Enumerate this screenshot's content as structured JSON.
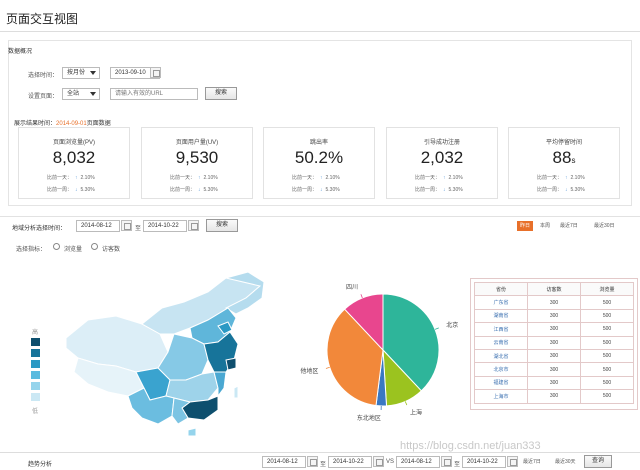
{
  "page": {
    "title": "页面交互视图"
  },
  "overview": {
    "section_title": "数据概况",
    "time_label": "选择时间：",
    "time_select": "按月份",
    "date_value": "2013-09-10",
    "page_label": "设置页面：",
    "page_select": "全站",
    "url_placeholder": "请输入有效的URL",
    "search_button": "搜索"
  },
  "display_time": {
    "prefix": "展示结果时间：",
    "date": "2014-09-01",
    "suffix": "页面数据"
  },
  "stats": [
    {
      "label": "页面浏览量(PV)",
      "value": "8,032",
      "unit": "",
      "day_label": "比前一天：",
      "day_value": "2.10%",
      "week_label": "比前一周：",
      "week_value": "5.30%"
    },
    {
      "label": "页面用户量(UV)",
      "value": "9,530",
      "unit": "",
      "day_label": "比前一天：",
      "day_value": "2.10%",
      "week_label": "比前一周：",
      "week_value": "5.30%"
    },
    {
      "label": "跳出率",
      "value": "50.2%",
      "unit": "",
      "day_label": "比前一天：",
      "day_value": "2.10%",
      "week_label": "比前一周：",
      "week_value": "5.30%"
    },
    {
      "label": "引导成功注册",
      "value": "2,032",
      "unit": "",
      "day_label": "比前一天：",
      "day_value": "2.10%",
      "week_label": "比前一周：",
      "week_value": "5.30%"
    },
    {
      "label": "平均停留时间",
      "value": "88",
      "unit": "s",
      "day_label": "比前一天：",
      "day_value": "2.10%",
      "week_label": "比前一周：",
      "week_value": "5.30%"
    }
  ],
  "geo": {
    "title": "地域分析",
    "time_label": "选择时间：",
    "date_from": "2014-08-12",
    "to_label": "至",
    "date_to": "2014-10-22",
    "search_button": "搜索",
    "quick": [
      "昨日",
      "本周",
      "最近7日",
      "最近30日"
    ],
    "metric_label": "选择指标：",
    "metric_pv": "浏览量",
    "metric_uv": "访客数",
    "legend_high": "高",
    "legend_low": "低"
  },
  "chart_data": {
    "type": "pie",
    "labels": [
      "北京",
      "上海",
      "东北地区",
      "其他地区",
      "四川"
    ],
    "values": [
      38,
      11,
      3,
      36,
      12
    ],
    "colors": [
      "#2eb59a",
      "#9bc31f",
      "#3a78c2",
      "#f2883a",
      "#e8468e"
    ]
  },
  "table": {
    "headers": [
      "省份",
      "访客数",
      "浏览量"
    ],
    "rows": [
      [
        "广东省",
        "300",
        "500"
      ],
      [
        "湖南省",
        "300",
        "500"
      ],
      [
        "江西省",
        "300",
        "500"
      ],
      [
        "云南省",
        "300",
        "500"
      ],
      [
        "湖北省",
        "300",
        "500"
      ],
      [
        "北京市",
        "300",
        "500"
      ],
      [
        "福建省",
        "300",
        "500"
      ],
      [
        "上海市",
        "300",
        "500"
      ]
    ]
  },
  "trend": {
    "title": "趋势分析",
    "date_a_from": "2014-08-12",
    "to_label": "至",
    "date_a_to": "2014-10-22",
    "vs_label": "VS",
    "date_b_from": "2014-08-12",
    "date_b_to": "2014-10-22",
    "quick_a": "最近7日",
    "quick_b": "最近30天",
    "search_button": "查询"
  },
  "watermark": "https://blog.csdn.net/juan333"
}
